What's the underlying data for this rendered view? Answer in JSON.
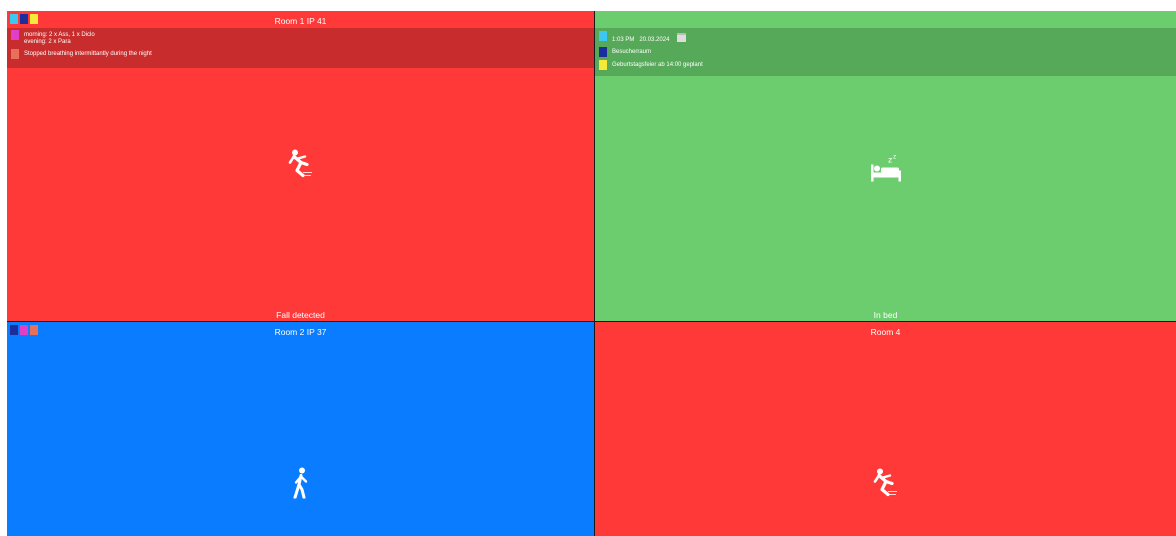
{
  "colors": {
    "alarm_red": "#ff3838",
    "ok_green": "#6bcd6d",
    "info_blue": "#0a7cff",
    "note_band_red": "#c82c2c",
    "note_band_green": "#57a95a",
    "square_cyan": "#3cc8f0",
    "square_navy": "#1a2f9c",
    "square_yellow": "#f5e93a",
    "square_magenta": "#e040c8",
    "square_salmon": "#e86f5a"
  },
  "tiles": {
    "room1": {
      "title": "Room 1 IP 41",
      "status": "Fall detected",
      "icon": "fall-icon",
      "squares": [
        "#3cc8f0",
        "#1a2f9c",
        "#f5e93a"
      ],
      "notes": [
        {
          "color": "#e040c8",
          "lines": [
            "morning: 2 x Ass, 1 x Diclo",
            "evening: 2 x Para"
          ]
        },
        {
          "color": "#e86f5a",
          "lines": [
            "Stopped breathing intermittantly during the night"
          ]
        }
      ]
    },
    "room_tr": {
      "title": "",
      "status": "In bed",
      "icon": "sleeping-in-bed-icon",
      "notes": [
        {
          "color": "#3cc8f0",
          "time": "1:03 PM",
          "date": "20.03.2024",
          "icon": "calendar-icon"
        },
        {
          "color": "#1a2f9c",
          "lines": [
            "Besucherraum"
          ]
        },
        {
          "color": "#f5e93a",
          "lines": [
            "Geburtstagsfeier ab 14:00 geplant"
          ]
        }
      ]
    },
    "room2": {
      "title": "Room 2 IP 37",
      "status": "",
      "icon": "walking-person-icon",
      "squares": [
        "#1a2f9c",
        "#e040c8",
        "#e86f5a"
      ]
    },
    "room4": {
      "title": "Room 4",
      "status": "",
      "icon": "fall-icon"
    }
  }
}
